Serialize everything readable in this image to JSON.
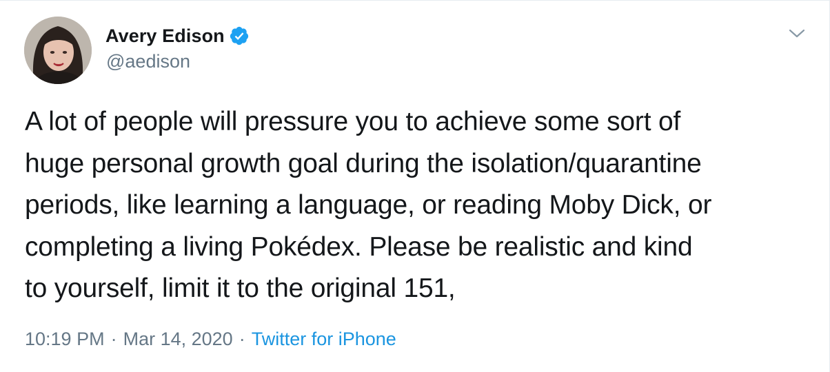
{
  "author": {
    "display_name": "Avery Edison",
    "handle": "@aedison",
    "verified": true
  },
  "icons": {
    "verified": "verified-badge-icon",
    "menu": "chevron-down-icon"
  },
  "tweet": {
    "text": "A lot of people will pressure you to achieve some sort of\nhuge personal growth goal during the isolation/quarantine\nperiods, like learning a language, or reading Moby Dick, or\ncompleting a living Pokédex. Please be realistic and kind\nto yourself, limit it to the original 151,"
  },
  "meta": {
    "time": "10:19 PM",
    "separator_1": "·",
    "date": "Mar 14, 2020",
    "separator_2": "·",
    "source": "Twitter for iPhone"
  },
  "colors": {
    "text": "#14171a",
    "secondary": "#657786",
    "link": "#1b95e0",
    "verified": "#1da1f2",
    "border": "#e6ecf0"
  }
}
